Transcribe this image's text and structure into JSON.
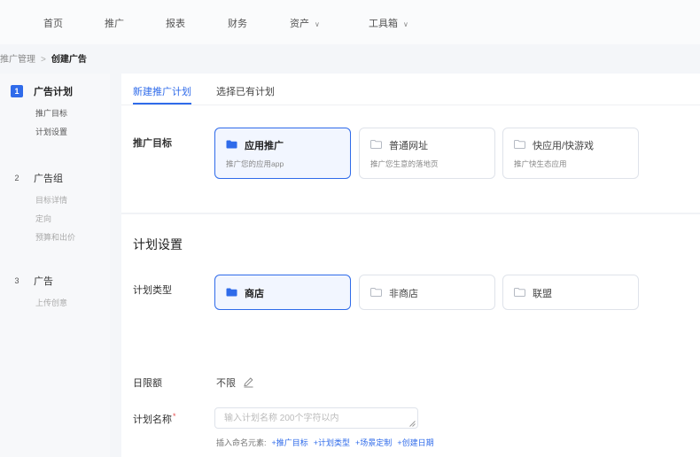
{
  "topnav": {
    "items": [
      {
        "label": "首页",
        "caret": ""
      },
      {
        "label": "推广",
        "caret": ""
      },
      {
        "label": "报表",
        "caret": ""
      },
      {
        "label": "财务",
        "caret": ""
      },
      {
        "label": "资产",
        "caret": "∨"
      },
      {
        "label": "工具箱",
        "caret": "∨"
      }
    ]
  },
  "breadcrumb": {
    "parent": "推广管理",
    "separator": ">",
    "current": "创建广告"
  },
  "steps": [
    {
      "num": "1",
      "title": "广告计划",
      "subs": [
        "推广目标",
        "计划设置"
      ]
    },
    {
      "num": "2",
      "title": "广告组",
      "subs": [
        "目标详情",
        "定向",
        "预算和出价"
      ]
    },
    {
      "num": "3",
      "title": "广告",
      "subs": [
        "上传创意"
      ]
    }
  ],
  "tabs": {
    "new_plan": "新建推广计划",
    "existing_plan": "选择已有计划"
  },
  "objective": {
    "label": "推广目标",
    "options": [
      {
        "title": "应用推广",
        "desc": "推广您的应用app"
      },
      {
        "title": "普通网址",
        "desc": "推广您生意的落地页"
      },
      {
        "title": "快应用/快游戏",
        "desc": "推广快生态应用"
      }
    ]
  },
  "plan_settings": {
    "title": "计划设置",
    "type_label": "计划类型",
    "types": [
      {
        "title": "商店"
      },
      {
        "title": "非商店"
      },
      {
        "title": "联盟"
      }
    ],
    "daily_limit_label": "日限额",
    "daily_limit_value": "不限",
    "name_label": "计划名称",
    "name_required_mark": "*",
    "name_placeholder": "输入计划名称 200个字符以内",
    "insert_label": "插入命名元素:",
    "insert_tags": [
      "+推广目标",
      "+计划类型",
      "+场景定制",
      "+创建日期"
    ]
  },
  "colors": {
    "accent": "#2f6bea",
    "selected_bg": "#f2f6ff",
    "required": "#e34d4d"
  }
}
